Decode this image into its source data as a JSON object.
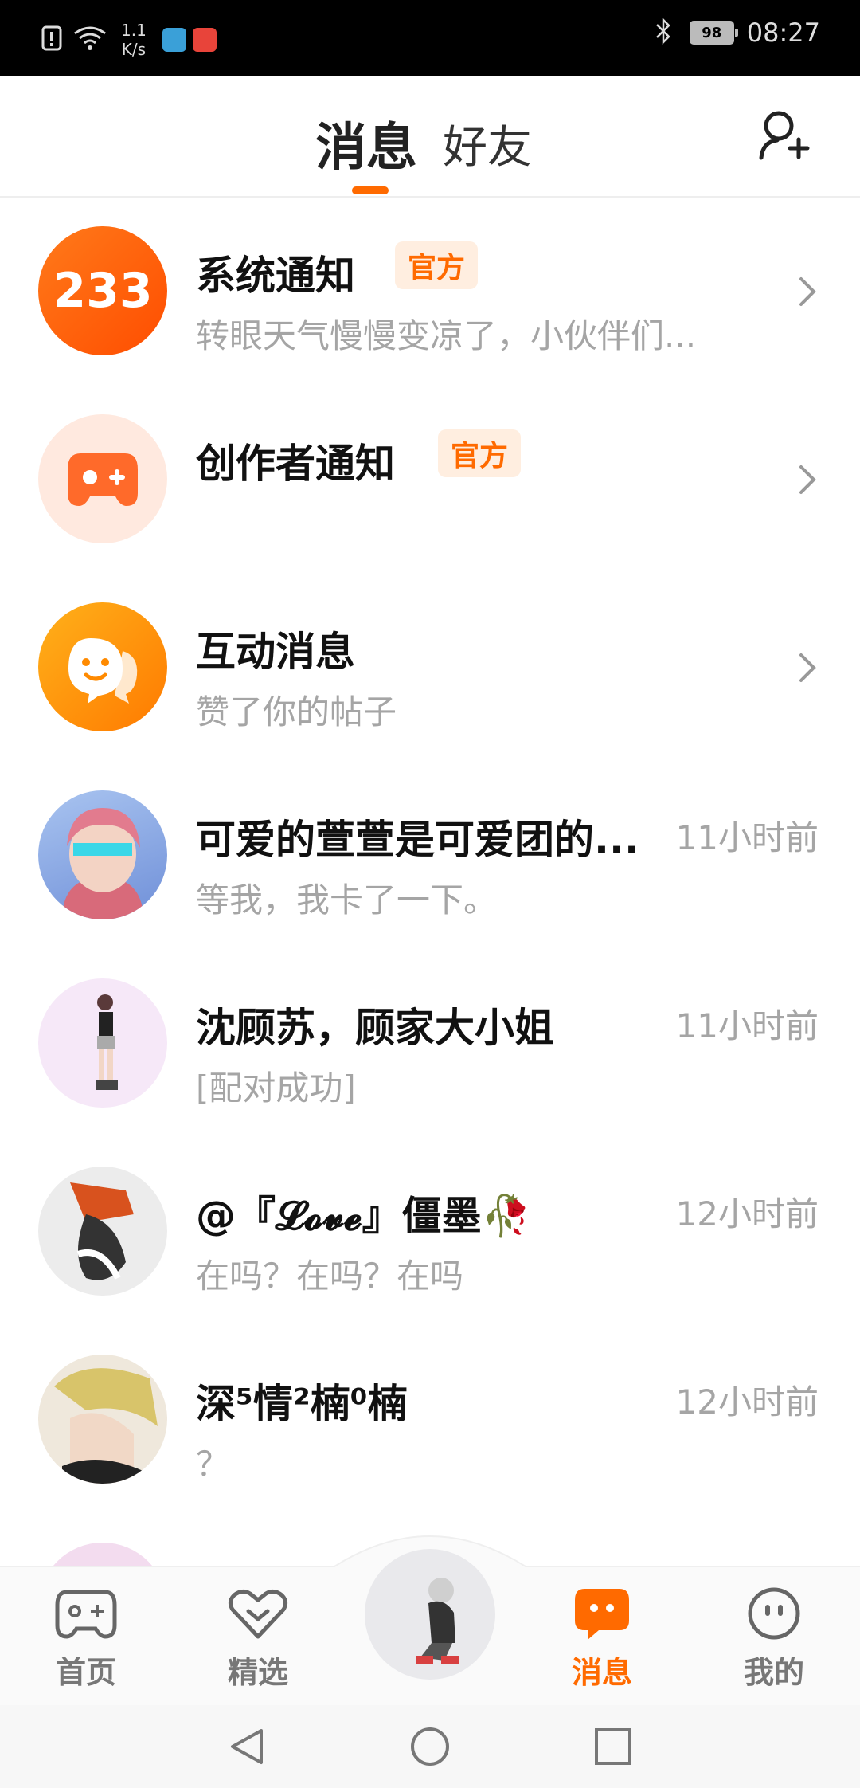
{
  "status_bar": {
    "speed_value": "1.1",
    "speed_unit": "K/s",
    "battery": "98",
    "time": "08:27"
  },
  "header": {
    "tab_active": "消息",
    "tab_other": "好友",
    "add_friend_icon": "add-user-icon"
  },
  "accent_color": "#ff6a00",
  "messages": [
    {
      "title": "系统通知",
      "badge": "官方",
      "subtitle": "转眼天气慢慢变凉了，小伙伴们...",
      "avatar_text": "233",
      "trailing": "chevron"
    },
    {
      "title": "创作者通知",
      "badge": "官方",
      "subtitle": "",
      "trailing": "chevron"
    },
    {
      "title": "互动消息",
      "badge": "",
      "subtitle": "赞了你的帖子",
      "trailing": "chevron"
    },
    {
      "title": "可爱的萱萱是可爱团的...",
      "subtitle": "等我，我卡了一下。",
      "time": "11小时前"
    },
    {
      "title": "沈顾苏，顾家大小姐",
      "subtitle": "[配对成功]",
      "time": "11小时前"
    },
    {
      "title": "@『𝓛𝓸𝓿𝓮』僵墨🥀",
      "subtitle": "在吗？在吗？在吗",
      "time": "12小时前"
    },
    {
      "title": "深⁵情²楠⁰楠",
      "subtitle": "？",
      "time": "12小时前"
    }
  ],
  "bottom_nav": {
    "home": "首页",
    "featured": "精选",
    "messages": "消息",
    "mine": "我的"
  }
}
